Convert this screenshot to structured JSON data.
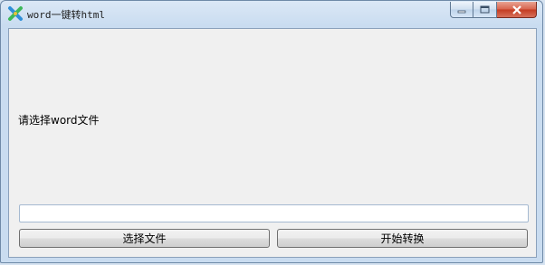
{
  "window": {
    "title": "word一键转html"
  },
  "main": {
    "prompt_label": "请选择word文件",
    "path_input": {
      "value": "",
      "placeholder": ""
    },
    "select_button_label": "选择文件",
    "start_button_label": "开始转换"
  },
  "icons": {
    "app": "app-logo-icon",
    "minimize": "minimize-icon",
    "maximize": "maximize-icon",
    "close": "close-icon"
  },
  "colors": {
    "client_background": "#f0f0f0",
    "close_button": "#c9452c"
  }
}
